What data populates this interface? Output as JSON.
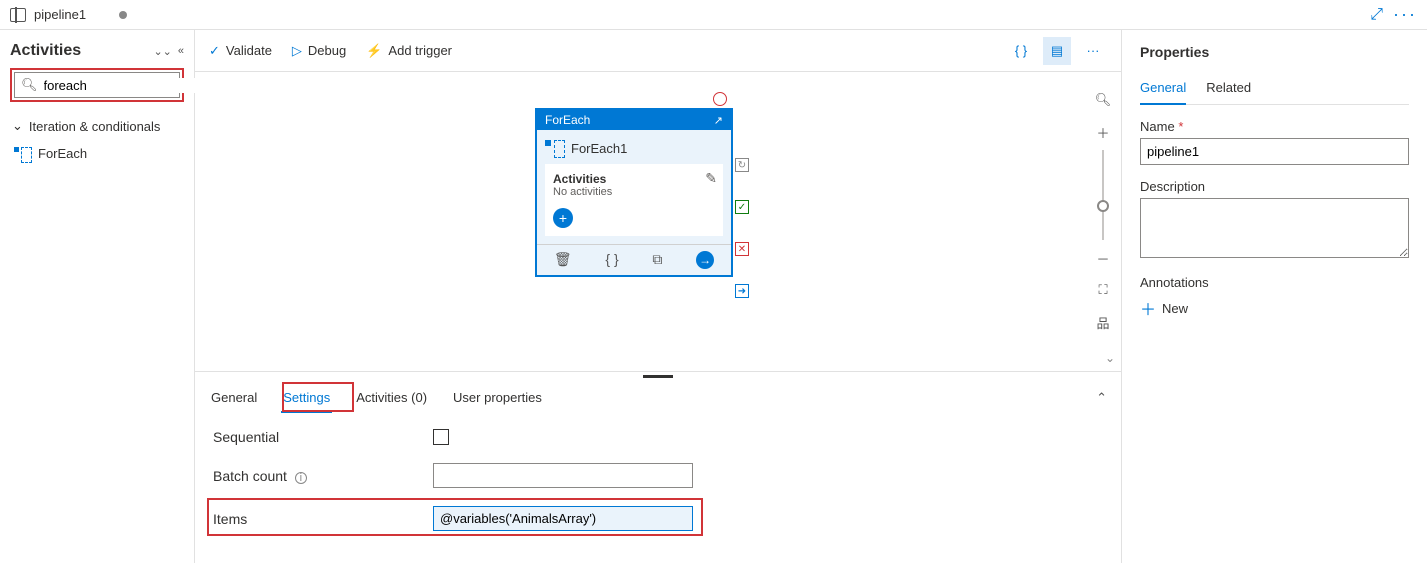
{
  "topbar": {
    "pipeline_name": "pipeline1"
  },
  "sidebar": {
    "title": "Activities",
    "search_value": "foreach",
    "group_label": "Iteration & conditionals",
    "activity_item": "ForEach"
  },
  "toolbar": {
    "validate": "Validate",
    "debug": "Debug",
    "add_trigger": "Add trigger"
  },
  "node": {
    "type_label": "ForEach",
    "name": "ForEach1",
    "activities_label": "Activities",
    "activities_sub": "No activities"
  },
  "settings": {
    "tabs": {
      "general": "General",
      "settings": "Settings",
      "activities": "Activities (0)",
      "user_props": "User properties"
    },
    "sequential_label": "Sequential",
    "batch_label": "Batch count",
    "items_label": "Items",
    "items_value": "@variables('AnimalsArray')"
  },
  "properties": {
    "title": "Properties",
    "tabs": {
      "general": "General",
      "related": "Related"
    },
    "name_label": "Name",
    "name_value": "pipeline1",
    "desc_label": "Description",
    "annotations_label": "Annotations",
    "new_label": "New"
  }
}
